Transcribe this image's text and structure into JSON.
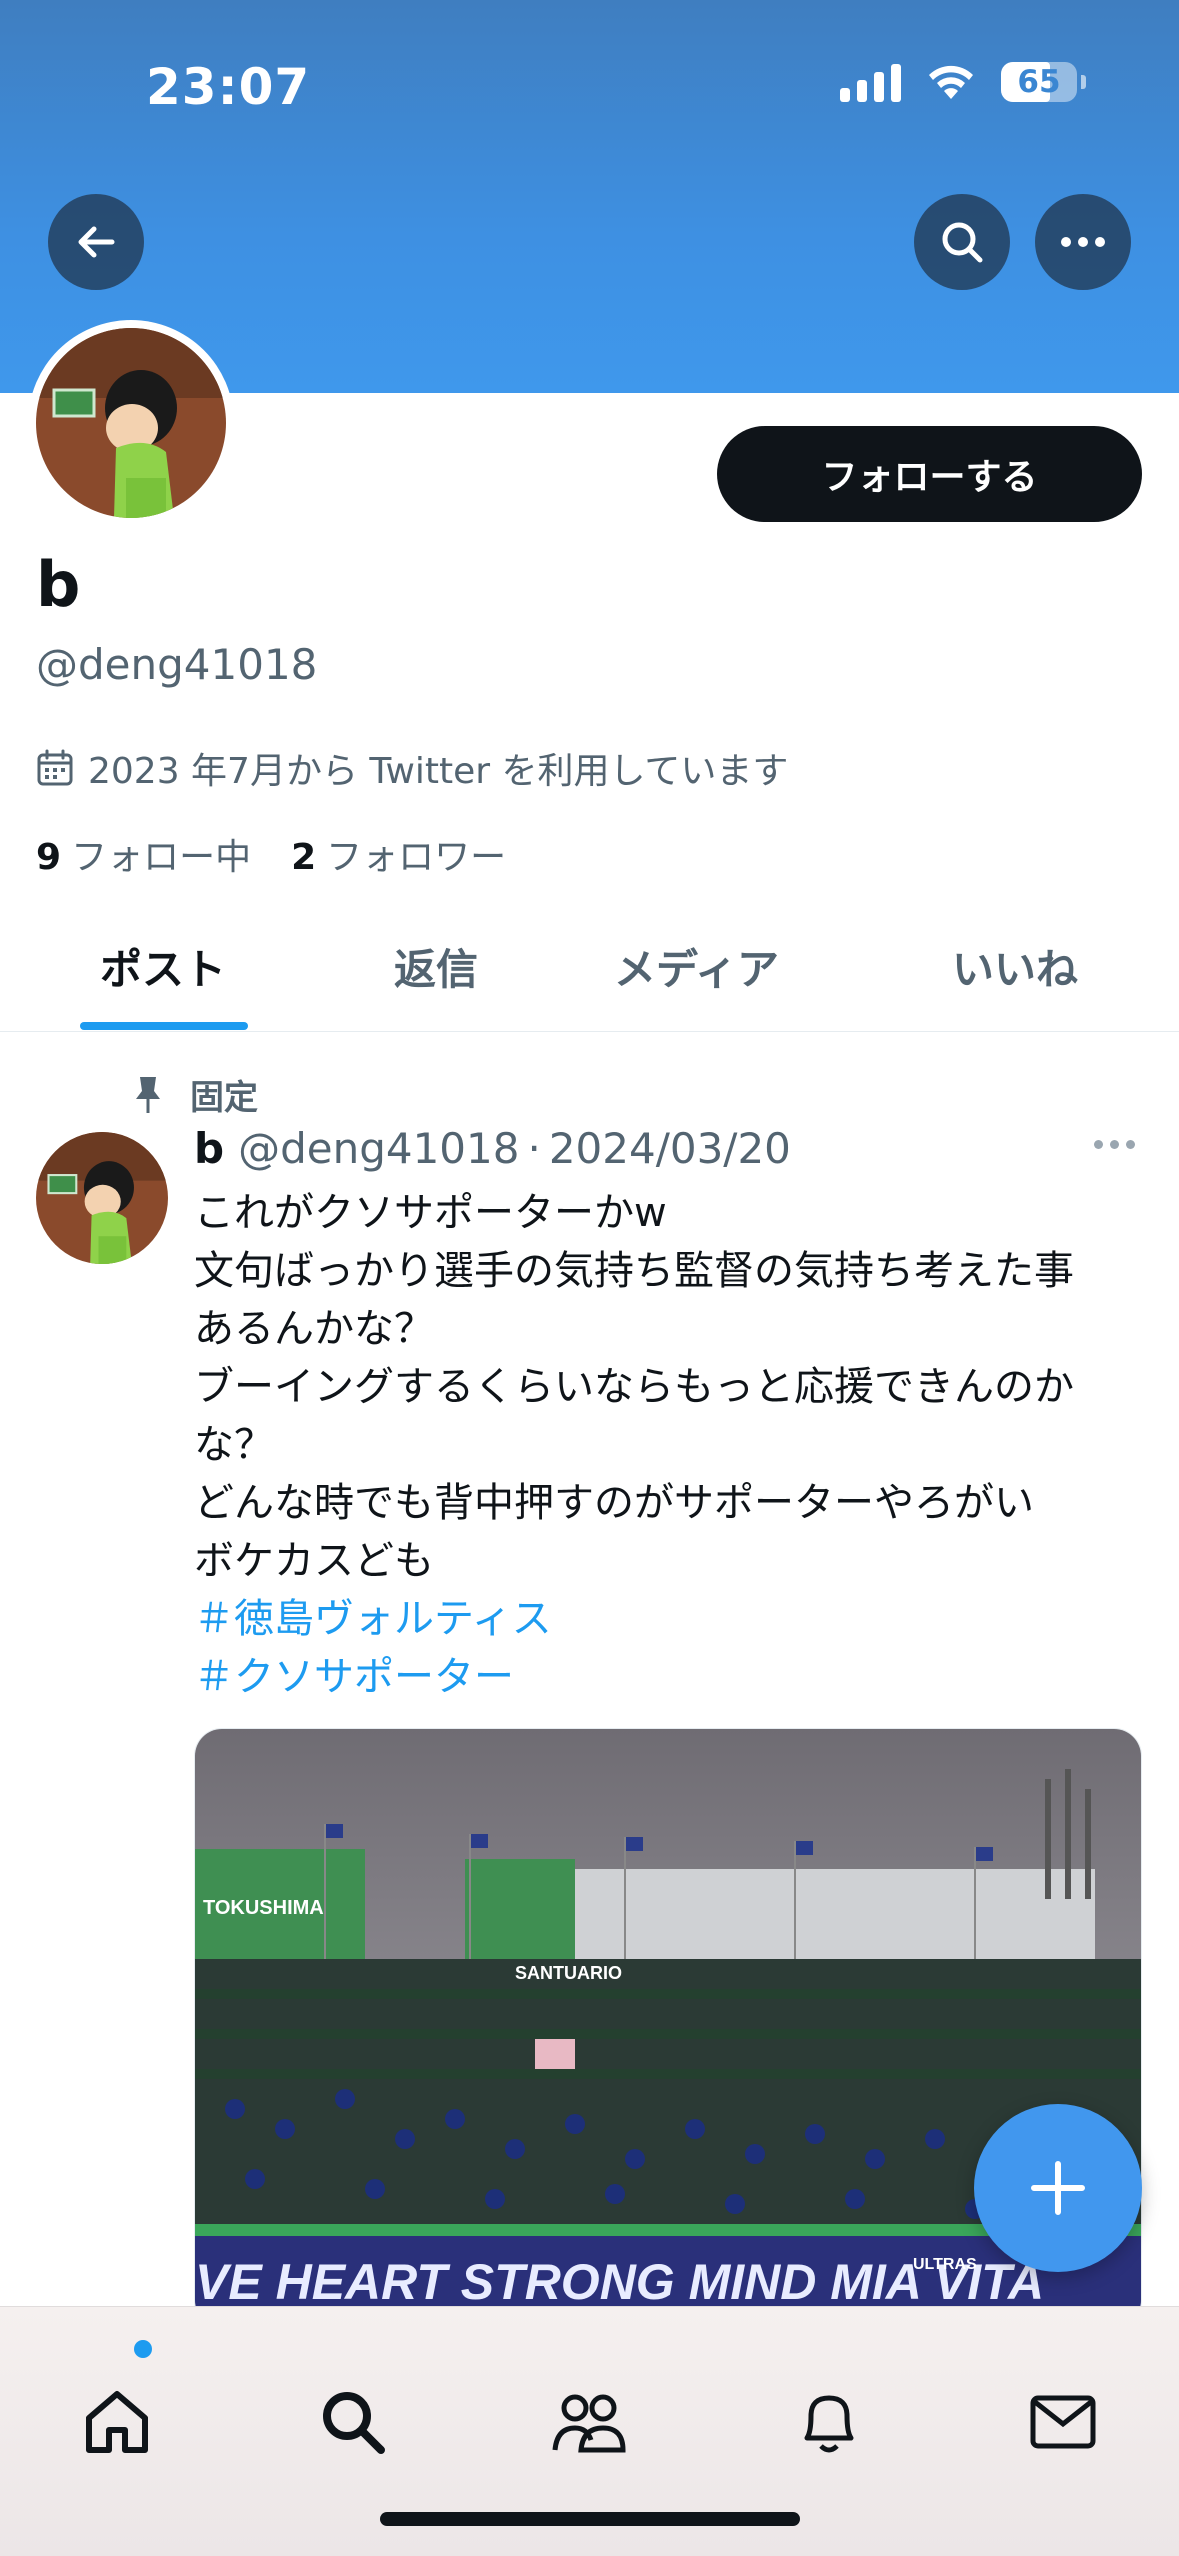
{
  "status_bar": {
    "time": "23:07",
    "battery": "65"
  },
  "colors": {
    "banner": "#3f8fdf",
    "accent": "#1d9bf0",
    "button_dark": "#0f1419",
    "fab": "#4197ee"
  },
  "header": {
    "back_icon": "back-arrow-icon",
    "search_icon": "search-icon",
    "more_icon": "more-horizontal-icon"
  },
  "profile": {
    "follow_label": "フォローする",
    "name": "b",
    "handle": "@deng41018",
    "joined": "2023 年7月から Twitter を利用しています",
    "following_count": "9",
    "following_label": "フォロー中",
    "followers_count": "2",
    "followers_label": "フォロワー"
  },
  "tabs": [
    {
      "label": "ポスト",
      "active": true
    },
    {
      "label": "返信",
      "active": false
    },
    {
      "label": "メディア",
      "active": false
    },
    {
      "label": "いいね",
      "active": false
    }
  ],
  "post": {
    "pinned_label": "固定",
    "author_name": "b",
    "author_handle": "@deng41018",
    "separator": "·",
    "date": "2024/03/20",
    "lines": [
      "これがクソサポーターかw",
      "文句ばっかり選手の気持ち監督の気持ち考えた事",
      "あるんかな？",
      "ブーイングするくらいならもっと応援できんのか",
      "な？",
      "どんな時でも背中押すのがサポーターやろがい",
      "ボケカスども"
    ],
    "hashtags": [
      "＃徳島ヴォルティス",
      "＃クソサポーター"
    ],
    "media": {
      "banner_left": "TOKUSHIMA",
      "banner_mid": "SANTUARIO",
      "banner_bottom": "VE HEART STRONG MIND MIA VITA",
      "banner_small": "ULTRAS"
    }
  },
  "bottom_nav": [
    {
      "icon": "home-icon",
      "has_badge": true
    },
    {
      "icon": "search-icon",
      "has_badge": false
    },
    {
      "icon": "communities-icon",
      "has_badge": false
    },
    {
      "icon": "notifications-bell-icon",
      "has_badge": false
    },
    {
      "icon": "messages-mail-icon",
      "has_badge": false
    }
  ]
}
